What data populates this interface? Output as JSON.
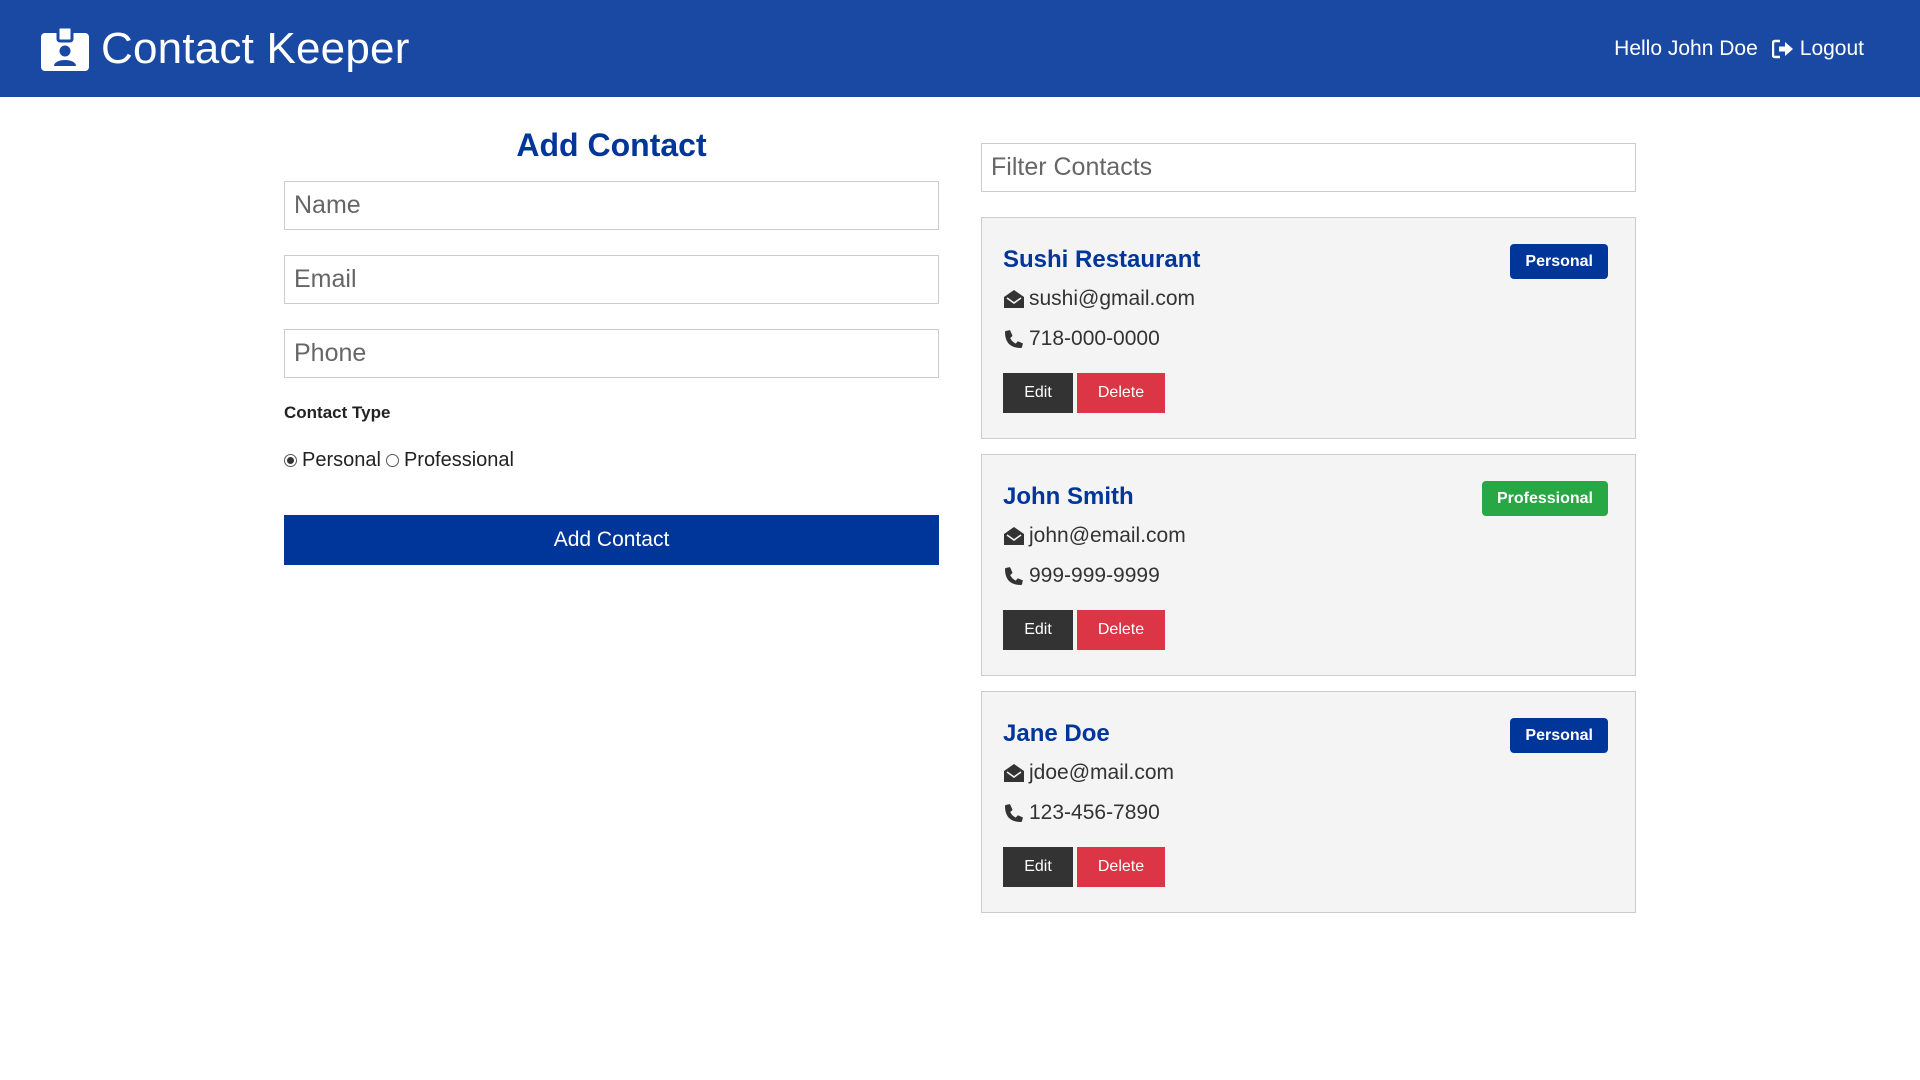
{
  "navbar": {
    "title": "Contact Keeper",
    "brand_icon": "id-badge-icon",
    "greeting": "Hello John Doe",
    "logout_label": "Logout",
    "logout_icon": "sign-out-icon",
    "color": "#1a49a3"
  },
  "form": {
    "title": "Add Contact",
    "name_placeholder": "Name",
    "email_placeholder": "Email",
    "phone_placeholder": "Phone",
    "type_label": "Contact Type",
    "types": [
      {
        "label": "Personal",
        "checked": true
      },
      {
        "label": "Professional",
        "checked": false
      }
    ],
    "submit_label": "Add Contact"
  },
  "filter": {
    "placeholder": "Filter Contacts"
  },
  "contacts": [
    {
      "name": "Sushi Restaurant",
      "type": "Personal",
      "email": "sushi@gmail.com",
      "phone": "718-000-0000",
      "edit": "Edit",
      "delete": "Delete"
    },
    {
      "name": "John Smith",
      "type": "Professional",
      "email": "john@email.com",
      "phone": "999-999-9999",
      "edit": "Edit",
      "delete": "Delete"
    },
    {
      "name": "Jane Doe",
      "type": "Personal",
      "email": "jdoe@mail.com",
      "phone": "123-456-7890",
      "edit": "Edit",
      "delete": "Delete"
    }
  ],
  "colors": {
    "primary": "#003699",
    "success": "#28a745",
    "danger": "#dc3545",
    "dark": "#333333",
    "card_bg": "#f4f4f4"
  }
}
